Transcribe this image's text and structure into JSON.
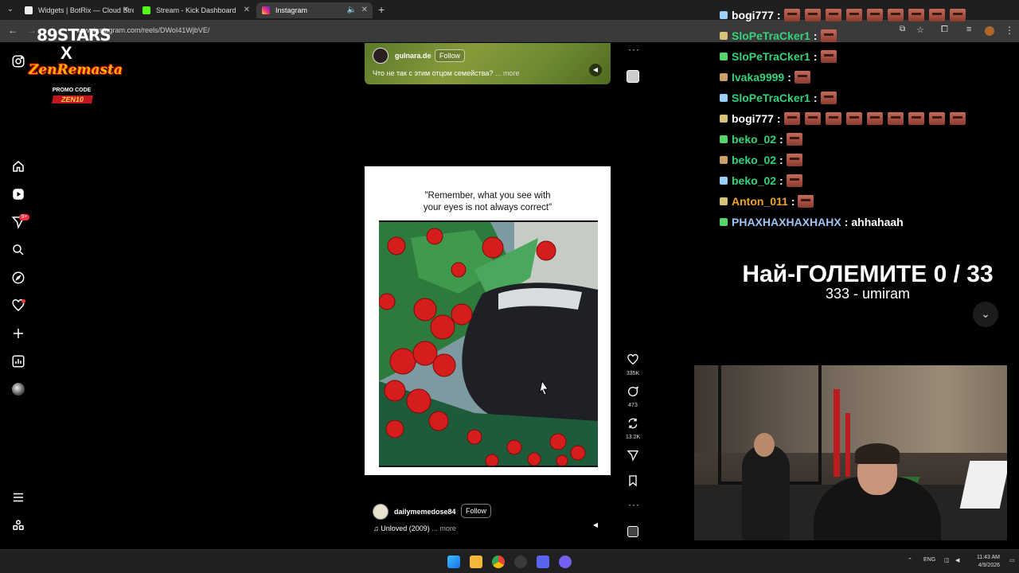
{
  "browser": {
    "tabs": [
      {
        "title": "Widgets | BotRix — Cloud Strea",
        "color": "#ffffff"
      },
      {
        "title": "Stream - Kick Dashboard",
        "color": "#53fc18"
      },
      {
        "title": "Instagram",
        "color": "#e1306c"
      }
    ],
    "url": "www.instagram.com/reels/DWoI41WjbVE/"
  },
  "overlay_logo": {
    "stars": "STARS",
    "stars_prefix": "89",
    "cross": "X",
    "brand": "ZenRemasta",
    "promo": "PROMO CODE",
    "code": "ZEN10"
  },
  "sidebar": {
    "notification_badge": "9+"
  },
  "reel_top": {
    "username": "gulnara.de",
    "follow": "Follow",
    "caption": "Что не так с этим отцом семейства?",
    "more": "... more"
  },
  "reel_main": {
    "quote_line1": "\"Remember, what you see with",
    "quote_line2": "your eyes is not always correct\"",
    "username": "dailymemedose84",
    "follow": "Follow",
    "caption": "Unloved (2009)",
    "more": "... more"
  },
  "actions": {
    "likes": "335K",
    "comments": "473",
    "reposts": "13.2K"
  },
  "chat": [
    {
      "user": "bogi777",
      "color": "#ffffff",
      "emotes": 9,
      "msg": ""
    },
    {
      "user": "SloPeTraCker1",
      "color": "#34d37a",
      "emotes": 1,
      "msg": ""
    },
    {
      "user": "SloPeTraCker1",
      "color": "#34d37a",
      "emotes": 1,
      "msg": ""
    },
    {
      "user": "Ivaka9999",
      "color": "#34d37a",
      "emotes": 1,
      "msg": ""
    },
    {
      "user": "SloPeTraCker1",
      "color": "#34d37a",
      "emotes": 1,
      "msg": ""
    },
    {
      "user": "bogi777",
      "color": "#ffffff",
      "emotes": 9,
      "msg": ""
    },
    {
      "user": "beko_02",
      "color": "#34d37a",
      "emotes": 1,
      "msg": ""
    },
    {
      "user": "beko_02",
      "color": "#34d37a",
      "emotes": 1,
      "msg": ""
    },
    {
      "user": "beko_02",
      "color": "#34d37a",
      "emotes": 1,
      "msg": ""
    },
    {
      "user": "Anton_011",
      "color": "#f0a326",
      "emotes": 1,
      "msg": ""
    },
    {
      "user": "PHAXHAXHAXHAHX",
      "color": "#9fc3f6",
      "emotes": 0,
      "msg": "ahhahaah"
    }
  ],
  "goal": {
    "title": "Най-ГОЛЕМИТЕ 0 / 33",
    "subtitle": "333 - umiram"
  },
  "taskbar": {
    "lang": "ENG",
    "time": "11:43 AM",
    "date": "4/9/2026"
  }
}
